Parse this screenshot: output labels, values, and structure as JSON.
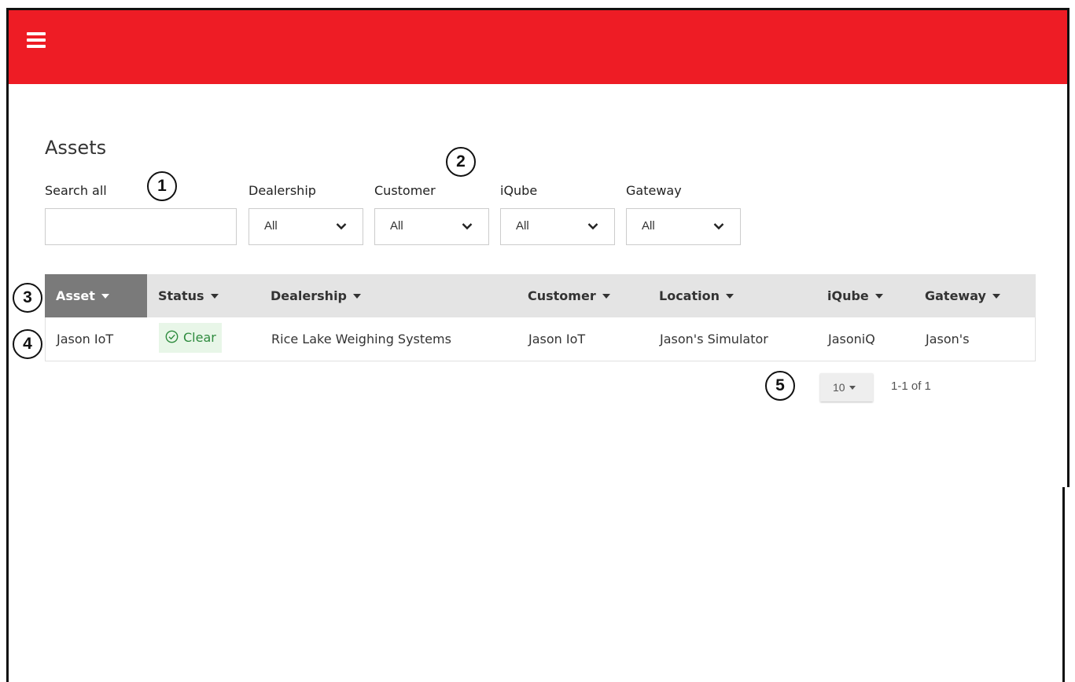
{
  "page": {
    "title": "Assets"
  },
  "filters": {
    "search_label": "Search all",
    "search_value": "",
    "dropdowns": [
      {
        "label": "Dealership",
        "value": "All"
      },
      {
        "label": "Customer",
        "value": "All"
      },
      {
        "label": "iQube",
        "value": "All"
      },
      {
        "label": "Gateway",
        "value": "All"
      }
    ]
  },
  "table": {
    "columns": [
      "Asset",
      "Status",
      "Dealership",
      "Customer",
      "Location",
      "iQube",
      "Gateway"
    ],
    "sorted_column": "Asset",
    "rows": [
      {
        "asset": "Jason IoT",
        "status": "Clear",
        "dealership": "Rice Lake Weighing Systems",
        "customer": "Jason IoT",
        "location": "Jason's Simulator",
        "iqube": "JasoniQ",
        "gateway": "Jason's"
      }
    ]
  },
  "pagination": {
    "page_size": "10",
    "range": "1-1 of 1"
  },
  "callouts": [
    "1",
    "2",
    "3",
    "4",
    "5"
  ],
  "colors": {
    "header": "#ee1c25",
    "active_column": "#7a7a7a",
    "status_clear": "#2e8b3e"
  },
  "icons": {
    "menu": "hamburger-icon",
    "select": "chevron-down-icon",
    "status": "check-circle-icon"
  }
}
